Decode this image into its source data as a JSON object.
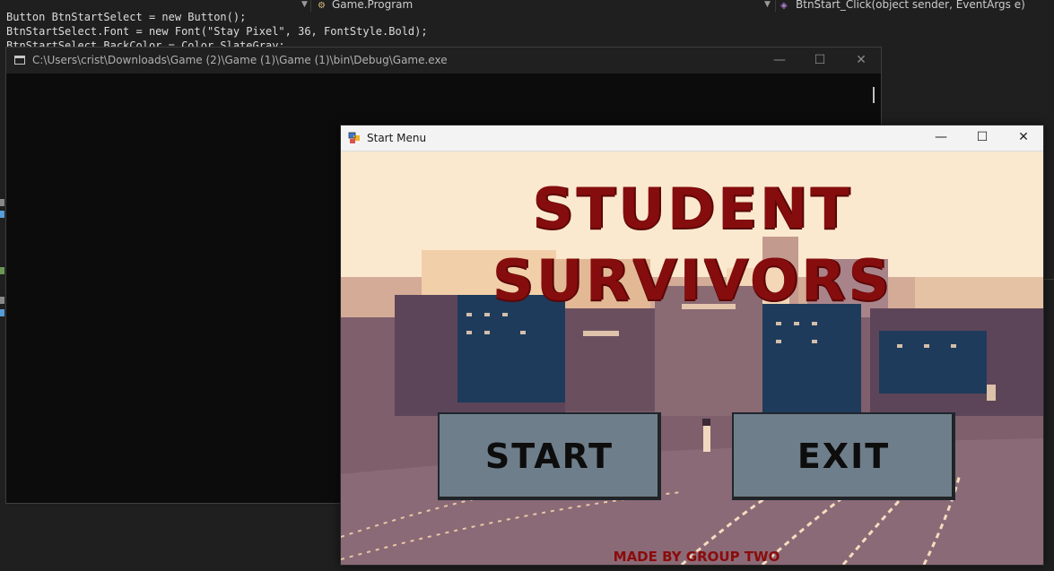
{
  "ide": {
    "nav": {
      "scope": "Game.Program",
      "member": "BtnStart_Click(object sender, EventArgs e)"
    },
    "code_lines": [
      "Button BtnStartSelect = new Button();",
      "BtnStartSelect.Font = new Font(\"Stay Pixel\", 36, FontStyle.Bold);",
      "BtnStartSelect.BackColor = Color.SlateGray;"
    ]
  },
  "console": {
    "title": "C:\\Users\\crist\\Downloads\\Game (2)\\Game (1)\\Game (1)\\bin\\Debug\\Game.exe"
  },
  "form": {
    "title": "Start Menu",
    "game_title": "STUDENT SURVIVORS",
    "start_label": "START",
    "exit_label": "EXIT",
    "credit": "MADE BY GROUP TWO"
  },
  "window_controls": {
    "minimize": "—",
    "maximize": "☐",
    "close": "✕"
  },
  "colors": {
    "title_red": "#860d0d",
    "button_slate": "#6f7e8b",
    "sky": "#fbe9cf",
    "ground": "#7f5f6c"
  }
}
